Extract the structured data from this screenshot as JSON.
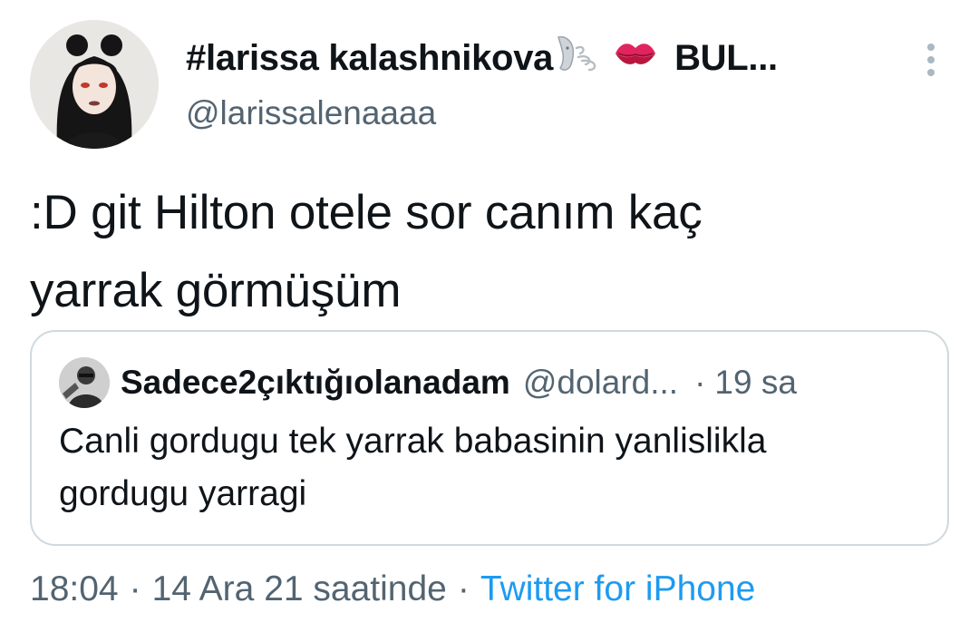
{
  "author": {
    "display_name": "#larissa kalashnikova",
    "display_name_suffix": "BUL...",
    "emojis": [
      "wind-blowing-face-icon",
      "kiss-mark-icon"
    ],
    "handle": "@larissalenaaaa"
  },
  "tweet": {
    "text_line1": ":D git Hilton otele sor canım kaç",
    "text_line2": "yarrak görmüşüm"
  },
  "quote": {
    "display_name": "Sadece2çıktığıolanadam",
    "handle": "@dolard...",
    "separator": "·",
    "time": "19 sa",
    "text_line1": "Canli gordugu tek yarrak babasinin yanlislikla",
    "text_line2": "gordugu yarragi"
  },
  "footer": {
    "time": "18:04",
    "separator1": "·",
    "date": "14 Ara 21 saatinde",
    "separator2": "·",
    "source": "Twitter for iPhone"
  },
  "colors": {
    "text": "#0f1419",
    "secondary": "#536471",
    "link": "#1d9bf0",
    "border": "#cfd9de"
  }
}
